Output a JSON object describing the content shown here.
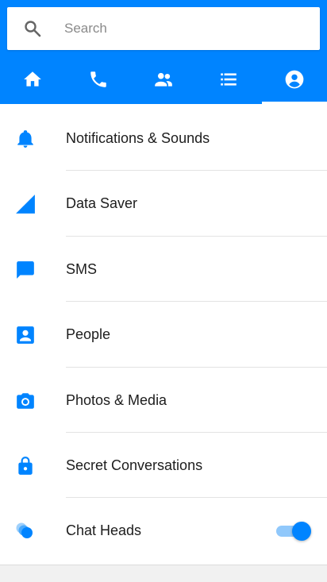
{
  "colors": {
    "accent": "#0084ff",
    "toggle_track": "#90c8fb",
    "text": "#1d1d1d",
    "divider": "#e3e3e3"
  },
  "search": {
    "placeholder": "Search",
    "icon": "search-icon"
  },
  "tabs": [
    {
      "icon": "home-icon",
      "active": false
    },
    {
      "icon": "phone-icon",
      "active": false
    },
    {
      "icon": "people-icon",
      "active": false
    },
    {
      "icon": "list-icon",
      "active": false
    },
    {
      "icon": "account-circle-icon",
      "active": true
    }
  ],
  "settings": {
    "items": [
      {
        "label": "Notifications & Sounds",
        "icon": "bell-icon"
      },
      {
        "label": "Data Saver",
        "icon": "signal-icon"
      },
      {
        "label": "SMS",
        "icon": "message-icon"
      },
      {
        "label": "People",
        "icon": "contact-icon"
      },
      {
        "label": "Photos & Media",
        "icon": "camera-icon"
      },
      {
        "label": "Secret Conversations",
        "icon": "lock-icon"
      },
      {
        "label": "Chat Heads",
        "icon": "chat-heads-icon",
        "toggle_on": true
      }
    ]
  }
}
